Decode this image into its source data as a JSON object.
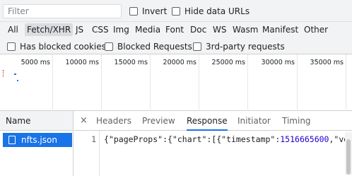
{
  "filter": {
    "placeholder": "Filter"
  },
  "toolbar": {
    "invert_label": "Invert",
    "hide_data_urls_label": "Hide data URLs"
  },
  "type_filters": [
    "All",
    "Fetch/XHR",
    "JS",
    "CSS",
    "Img",
    "Media",
    "Font",
    "Doc",
    "WS",
    "Wasm",
    "Manifest",
    "Other"
  ],
  "active_type_filter": "Fetch/XHR",
  "options": {
    "has_blocked_cookies": "Has blocked cookies",
    "blocked_requests": "Blocked Requests",
    "third_party": "3rd-party requests"
  },
  "timeline": {
    "ticks": [
      "5000 ms",
      "10000 ms",
      "15000 ms",
      "20000 ms",
      "25000 ms",
      "30000 ms",
      "35000 ms"
    ]
  },
  "requests": {
    "header": "Name",
    "items": [
      {
        "name": "nfts.json",
        "selected": true
      }
    ]
  },
  "detail": {
    "close_glyph": "×",
    "tabs": [
      "Headers",
      "Preview",
      "Response",
      "Initiator",
      "Timing"
    ],
    "active_tab": "Response",
    "line_number": "1",
    "code": {
      "p1": "{\"pageProps\":{\"chart\":[{\"timestamp\":",
      "num": "1516665600",
      "p2": ",\"volu"
    }
  },
  "colors": {
    "accent": "#1a73e8",
    "number": "#1c00cf"
  }
}
